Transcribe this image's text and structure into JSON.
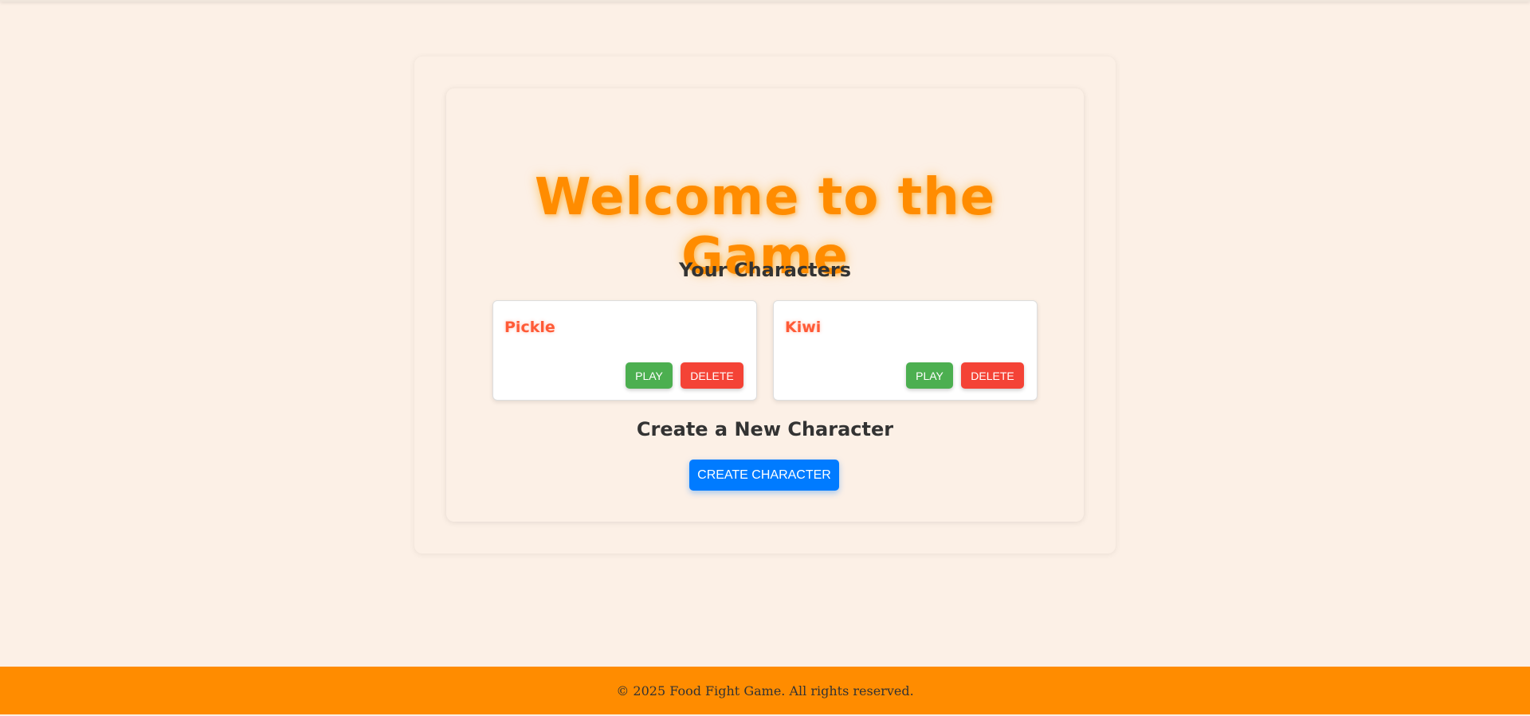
{
  "main": {
    "title": "Welcome to the Game",
    "characters_heading": "Your Characters",
    "characters": [
      {
        "name": "Pickle",
        "play_label": "PLAY",
        "delete_label": "DELETE"
      },
      {
        "name": "Kiwi",
        "play_label": "PLAY",
        "delete_label": "DELETE"
      }
    ],
    "create_heading": "Create a New Character",
    "create_button_label": "CREATE CHARACTER"
  },
  "footer": {
    "text": "© 2025 Food Fight Game. All rights reserved."
  },
  "colors": {
    "page_background": "#fcf0e6",
    "title": "#ff8c00",
    "character_name": "#ff5a36",
    "play_button": "#4caf50",
    "delete_button": "#f44336",
    "create_button": "#007bff",
    "footer_background": "#ff8c00"
  }
}
